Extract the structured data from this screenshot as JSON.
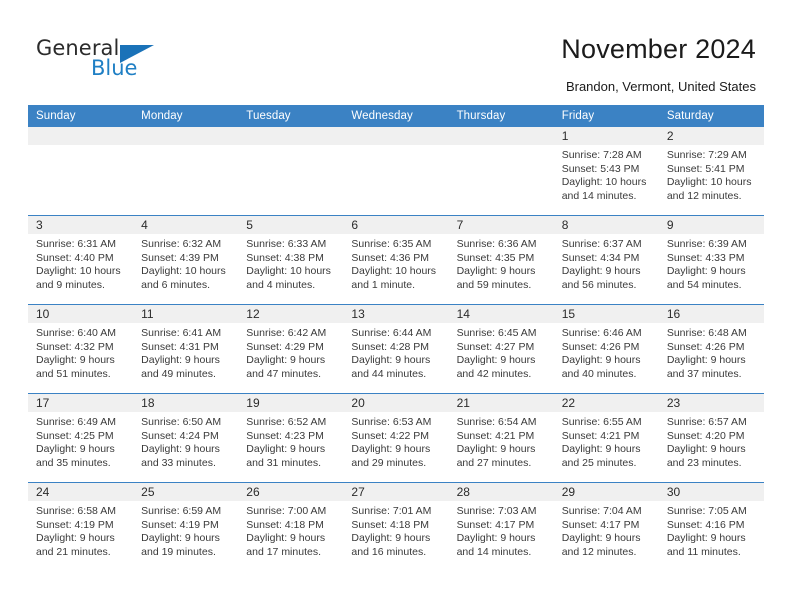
{
  "brand": {
    "name_part1": "General",
    "name_part2": "Blue",
    "logo_icon": "triangle-logo-icon"
  },
  "header": {
    "title": "November 2024",
    "location": "Brandon, Vermont, United States"
  },
  "colors": {
    "header_blue": "#3b82c4",
    "brand_blue": "#1f7fc4",
    "daynum_band": "#f0f0f0",
    "text": "#3a3a3a"
  },
  "calendar": {
    "weekday_headers": [
      "Sunday",
      "Monday",
      "Tuesday",
      "Wednesday",
      "Thursday",
      "Friday",
      "Saturday"
    ],
    "labels": {
      "sunrise": "Sunrise:",
      "sunset": "Sunset:",
      "daylight": "Daylight:"
    },
    "weeks": [
      [
        {
          "day": "",
          "empty": true
        },
        {
          "day": "",
          "empty": true
        },
        {
          "day": "",
          "empty": true
        },
        {
          "day": "",
          "empty": true
        },
        {
          "day": "",
          "empty": true
        },
        {
          "day": "1",
          "sunrise": "Sunrise: 7:28 AM",
          "sunset": "Sunset: 5:43 PM",
          "daylight": "Daylight: 10 hours and 14 minutes."
        },
        {
          "day": "2",
          "sunrise": "Sunrise: 7:29 AM",
          "sunset": "Sunset: 5:41 PM",
          "daylight": "Daylight: 10 hours and 12 minutes."
        }
      ],
      [
        {
          "day": "3",
          "sunrise": "Sunrise: 6:31 AM",
          "sunset": "Sunset: 4:40 PM",
          "daylight": "Daylight: 10 hours and 9 minutes."
        },
        {
          "day": "4",
          "sunrise": "Sunrise: 6:32 AM",
          "sunset": "Sunset: 4:39 PM",
          "daylight": "Daylight: 10 hours and 6 minutes."
        },
        {
          "day": "5",
          "sunrise": "Sunrise: 6:33 AM",
          "sunset": "Sunset: 4:38 PM",
          "daylight": "Daylight: 10 hours and 4 minutes."
        },
        {
          "day": "6",
          "sunrise": "Sunrise: 6:35 AM",
          "sunset": "Sunset: 4:36 PM",
          "daylight": "Daylight: 10 hours and 1 minute."
        },
        {
          "day": "7",
          "sunrise": "Sunrise: 6:36 AM",
          "sunset": "Sunset: 4:35 PM",
          "daylight": "Daylight: 9 hours and 59 minutes."
        },
        {
          "day": "8",
          "sunrise": "Sunrise: 6:37 AM",
          "sunset": "Sunset: 4:34 PM",
          "daylight": "Daylight: 9 hours and 56 minutes."
        },
        {
          "day": "9",
          "sunrise": "Sunrise: 6:39 AM",
          "sunset": "Sunset: 4:33 PM",
          "daylight": "Daylight: 9 hours and 54 minutes."
        }
      ],
      [
        {
          "day": "10",
          "sunrise": "Sunrise: 6:40 AM",
          "sunset": "Sunset: 4:32 PM",
          "daylight": "Daylight: 9 hours and 51 minutes."
        },
        {
          "day": "11",
          "sunrise": "Sunrise: 6:41 AM",
          "sunset": "Sunset: 4:31 PM",
          "daylight": "Daylight: 9 hours and 49 minutes."
        },
        {
          "day": "12",
          "sunrise": "Sunrise: 6:42 AM",
          "sunset": "Sunset: 4:29 PM",
          "daylight": "Daylight: 9 hours and 47 minutes."
        },
        {
          "day": "13",
          "sunrise": "Sunrise: 6:44 AM",
          "sunset": "Sunset: 4:28 PM",
          "daylight": "Daylight: 9 hours and 44 minutes."
        },
        {
          "day": "14",
          "sunrise": "Sunrise: 6:45 AM",
          "sunset": "Sunset: 4:27 PM",
          "daylight": "Daylight: 9 hours and 42 minutes."
        },
        {
          "day": "15",
          "sunrise": "Sunrise: 6:46 AM",
          "sunset": "Sunset: 4:26 PM",
          "daylight": "Daylight: 9 hours and 40 minutes."
        },
        {
          "day": "16",
          "sunrise": "Sunrise: 6:48 AM",
          "sunset": "Sunset: 4:26 PM",
          "daylight": "Daylight: 9 hours and 37 minutes."
        }
      ],
      [
        {
          "day": "17",
          "sunrise": "Sunrise: 6:49 AM",
          "sunset": "Sunset: 4:25 PM",
          "daylight": "Daylight: 9 hours and 35 minutes."
        },
        {
          "day": "18",
          "sunrise": "Sunrise: 6:50 AM",
          "sunset": "Sunset: 4:24 PM",
          "daylight": "Daylight: 9 hours and 33 minutes."
        },
        {
          "day": "19",
          "sunrise": "Sunrise: 6:52 AM",
          "sunset": "Sunset: 4:23 PM",
          "daylight": "Daylight: 9 hours and 31 minutes."
        },
        {
          "day": "20",
          "sunrise": "Sunrise: 6:53 AM",
          "sunset": "Sunset: 4:22 PM",
          "daylight": "Daylight: 9 hours and 29 minutes."
        },
        {
          "day": "21",
          "sunrise": "Sunrise: 6:54 AM",
          "sunset": "Sunset: 4:21 PM",
          "daylight": "Daylight: 9 hours and 27 minutes."
        },
        {
          "day": "22",
          "sunrise": "Sunrise: 6:55 AM",
          "sunset": "Sunset: 4:21 PM",
          "daylight": "Daylight: 9 hours and 25 minutes."
        },
        {
          "day": "23",
          "sunrise": "Sunrise: 6:57 AM",
          "sunset": "Sunset: 4:20 PM",
          "daylight": "Daylight: 9 hours and 23 minutes."
        }
      ],
      [
        {
          "day": "24",
          "sunrise": "Sunrise: 6:58 AM",
          "sunset": "Sunset: 4:19 PM",
          "daylight": "Daylight: 9 hours and 21 minutes."
        },
        {
          "day": "25",
          "sunrise": "Sunrise: 6:59 AM",
          "sunset": "Sunset: 4:19 PM",
          "daylight": "Daylight: 9 hours and 19 minutes."
        },
        {
          "day": "26",
          "sunrise": "Sunrise: 7:00 AM",
          "sunset": "Sunset: 4:18 PM",
          "daylight": "Daylight: 9 hours and 17 minutes."
        },
        {
          "day": "27",
          "sunrise": "Sunrise: 7:01 AM",
          "sunset": "Sunset: 4:18 PM",
          "daylight": "Daylight: 9 hours and 16 minutes."
        },
        {
          "day": "28",
          "sunrise": "Sunrise: 7:03 AM",
          "sunset": "Sunset: 4:17 PM",
          "daylight": "Daylight: 9 hours and 14 minutes."
        },
        {
          "day": "29",
          "sunrise": "Sunrise: 7:04 AM",
          "sunset": "Sunset: 4:17 PM",
          "daylight": "Daylight: 9 hours and 12 minutes."
        },
        {
          "day": "30",
          "sunrise": "Sunrise: 7:05 AM",
          "sunset": "Sunset: 4:16 PM",
          "daylight": "Daylight: 9 hours and 11 minutes."
        }
      ]
    ]
  }
}
